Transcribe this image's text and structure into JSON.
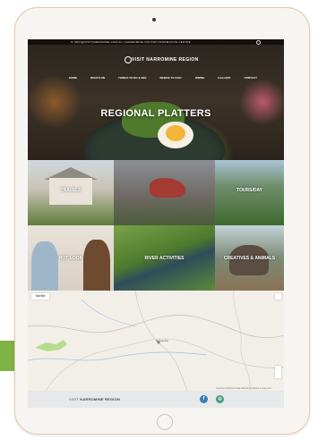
{
  "site": {
    "topbar_text": "✉ INFO@VISITNARROMINE.COM.AU  |  NARROMINE VISITOR INFORMATION CENTRE",
    "logo_text": "VISIT NARROMINE REGION",
    "nav": [
      "HOME",
      "WHATS ON",
      "THINGS TO DO & SEE",
      "WHERE TO STAY",
      "DINING",
      "GALLERY",
      "CONTACT"
    ],
    "hero_title": "REGIONAL PLATTERS"
  },
  "tiles": [
    {
      "label": "TRAVELS"
    },
    {
      "label": ""
    },
    {
      "label": "TOURS/DAY"
    },
    {
      "label": "HOT LOOK"
    },
    {
      "label": "RIVER ACTIVITIES"
    },
    {
      "label": "CREATIVES & ANIMALS"
    }
  ],
  "map": {
    "view_button": "Satellite",
    "town_label": "Narromine",
    "footer_text": "Keyboard shortcuts  Map data  Terms  Report a map error"
  },
  "footer": {
    "visit_prefix": "VISIT",
    "visit_name": "NARROMINE REGION",
    "social": [
      "f",
      "◎"
    ]
  },
  "colors": {
    "accent_green": "#7db344",
    "tablet_frame": "#e5c9ad",
    "social_facebook": "#3a7fb5",
    "social_other": "#4a9c7a"
  }
}
